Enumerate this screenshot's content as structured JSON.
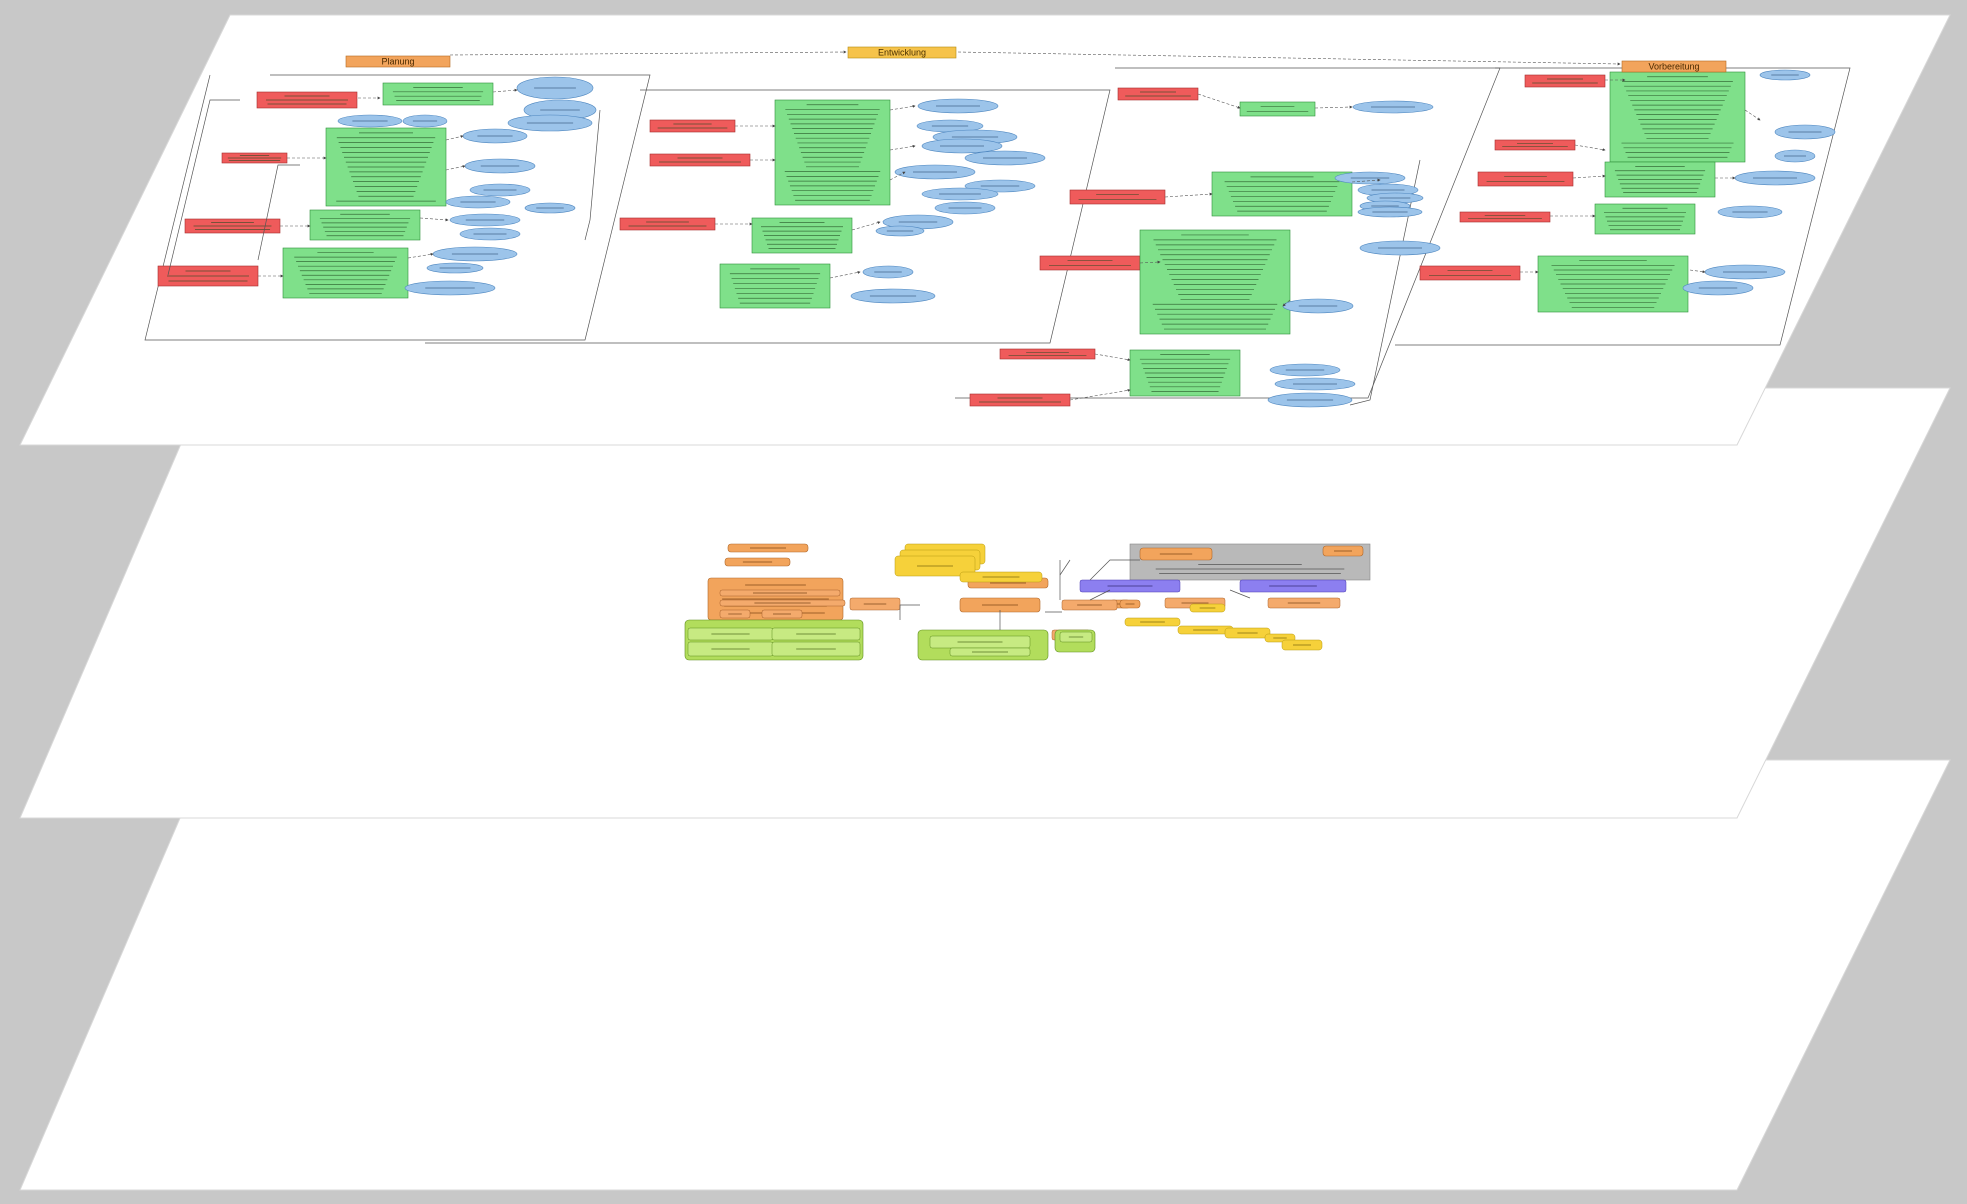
{
  "colors": {
    "background": "#c8c8c8",
    "plane_fill": "#ffffff",
    "plane_stroke": "#d0d0d0",
    "process_red": "#ef5b5b",
    "activity_green": "#7fe08a",
    "data_blue": "#9cc4ea",
    "phase_orange": "#f2a45c",
    "note_yellow": "#f6d13a",
    "lime": "#b2dd5c",
    "violet": "#8c7ff0",
    "grey_note": "#b9b9b9"
  },
  "top_plane": {
    "phases": [
      {
        "label": "Planung"
      },
      {
        "label": "Entwicklung"
      },
      {
        "label": "Vorbereitung"
      }
    ]
  },
  "icons": {
    "plane_icon": "layer-plane",
    "process_node": "red-rectangle",
    "activity_node": "green-rectangle",
    "data_node": "blue-ellipse"
  }
}
